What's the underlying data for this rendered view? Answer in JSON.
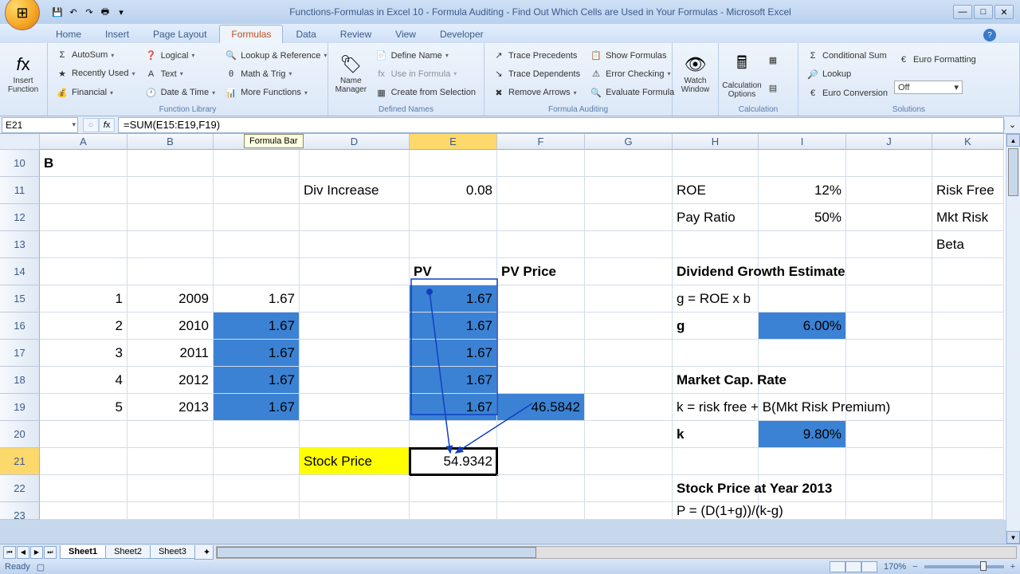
{
  "window": {
    "title": "Functions-Formulas in Excel 10 - Formula Auditing - Find Out Which Cells are Used in Your Formulas - Microsoft Excel"
  },
  "tabs": [
    "Home",
    "Insert",
    "Page Layout",
    "Formulas",
    "Data",
    "Review",
    "View",
    "Developer"
  ],
  "active_tab": 3,
  "ribbon": {
    "insert_function": "Insert Function",
    "autosum": "AutoSum",
    "recently_used": "Recently Used",
    "financial": "Financial",
    "logical": "Logical",
    "text": "Text",
    "date_time": "Date & Time",
    "lookup_ref": "Lookup & Reference",
    "math_trig": "Math & Trig",
    "more_functions": "More Functions",
    "group_function_library": "Function Library",
    "name_manager": "Name Manager",
    "define_name": "Define Name",
    "use_in_formula": "Use in Formula",
    "create_from_selection": "Create from Selection",
    "group_defined_names": "Defined Names",
    "trace_precedents": "Trace Precedents",
    "trace_dependents": "Trace Dependents",
    "remove_arrows": "Remove Arrows",
    "show_formulas": "Show Formulas",
    "error_checking": "Error Checking",
    "evaluate_formula": "Evaluate Formula",
    "group_formula_auditing": "Formula Auditing",
    "watch_window": "Watch Window",
    "calculation_options": "Calculation Options",
    "calc_now": "",
    "group_calculation": "Calculation",
    "conditional_sum": "Conditional Sum",
    "lookup": "Lookup",
    "euro_conversion": "Euro Conversion",
    "euro_formatting": "Euro Formatting",
    "off": "Off",
    "group_solutions": "Solutions"
  },
  "name_box": "E21",
  "formula": "=SUM(E15:E19,F19)",
  "tooltip": "Formula Bar",
  "columns": [
    "A",
    "B",
    "C",
    "D",
    "E",
    "F",
    "G",
    "H",
    "I",
    "J",
    "K"
  ],
  "rows_start": 10,
  "cells": {
    "A10": "B",
    "D11": "Div Increase",
    "E11": "0.08",
    "H11": "ROE",
    "I11": "12%",
    "K11": "Risk Free",
    "H12": "Pay Ratio",
    "I12": "50%",
    "K12": "Mkt Risk",
    "K13": "Beta",
    "E14": "PV",
    "F14": "PV Price",
    "H14": "Dividend Growth Estimate",
    "A15": "1",
    "B15": "2009",
    "C15": "1.67",
    "E15": "1.67",
    "H15": "g = ROE x b",
    "A16": "2",
    "B16": "2010",
    "C16": "1.67",
    "E16": "1.67",
    "H16": "g",
    "I16": "6.00%",
    "A17": "3",
    "B17": "2011",
    "C17": "1.67",
    "E17": "1.67",
    "A18": "4",
    "B18": "2012",
    "C18": "1.67",
    "E18": "1.67",
    "H18": "Market Cap. Rate",
    "A19": "5",
    "B19": "2013",
    "C19": "1.67",
    "E19": "1.67",
    "F19": "46.5842",
    "H19": "k = risk free + B(Mkt Risk Premium)",
    "H20": "k",
    "I20": "9.80%",
    "D21": "Stock Price",
    "E21": "54.9342",
    "H22": "Stock Price at Year 2013",
    "H23": "P = (D(1+g))/(k-g)"
  },
  "sheets": [
    "Sheet1",
    "Sheet2",
    "Sheet3"
  ],
  "status": {
    "ready": "Ready",
    "zoom": "170%"
  }
}
